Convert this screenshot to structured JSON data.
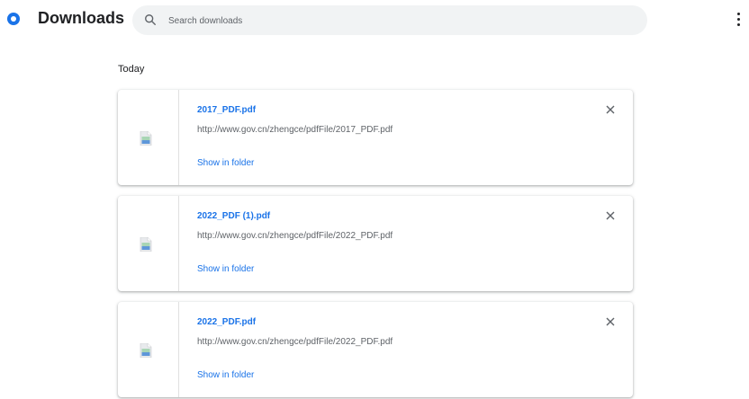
{
  "header": {
    "title": "Downloads",
    "search_placeholder": "Search downloads",
    "search_value": ""
  },
  "section_label": "Today",
  "items": [
    {
      "name": "2017_PDF.pdf",
      "url": "http://www.gov.cn/zhengce/pdfFile/2017_PDF.pdf",
      "action": "Show in folder"
    },
    {
      "name": "2022_PDF (1).pdf",
      "url": "http://www.gov.cn/zhengce/pdfFile/2022_PDF.pdf",
      "action": "Show in folder"
    },
    {
      "name": "2022_PDF.pdf",
      "url": "http://www.gov.cn/zhengce/pdfFile/2022_PDF.pdf",
      "action": "Show in folder"
    }
  ],
  "icons": {
    "logo": "chrome-logo-icon",
    "search": "search-icon",
    "more": "more-vert-icon",
    "file": "pdf-file-icon",
    "close": "close-icon"
  },
  "colors": {
    "accent": "#1a73e8",
    "search_bg": "#f1f3f4",
    "text": "#202124",
    "secondary_text": "#5f6368"
  }
}
